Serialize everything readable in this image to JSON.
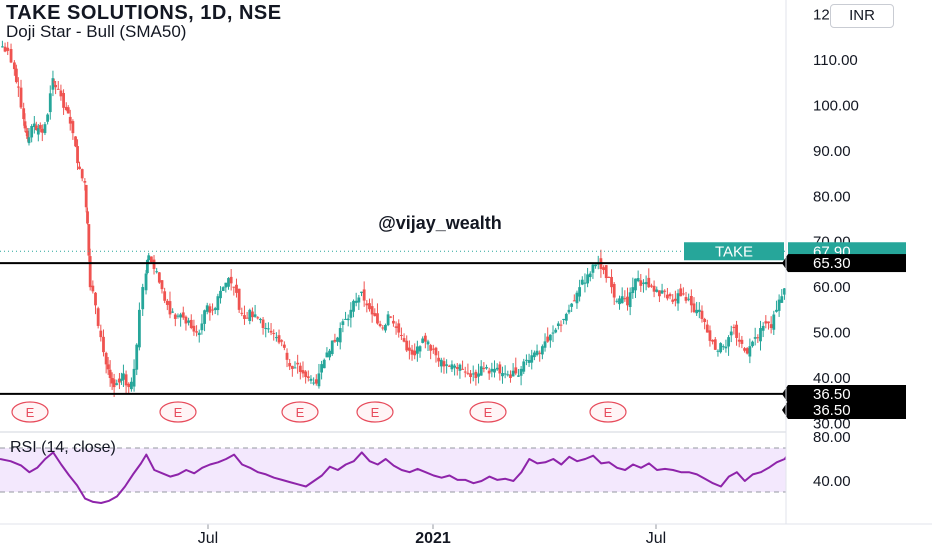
{
  "header": {
    "title": "TAKE SOLUTIONS, 1D, NSE",
    "indicator": "Doji Star - Bull (SMA50)",
    "currency": "INR"
  },
  "watermark": "@vijay_wealth",
  "colors": {
    "up": "#26a69a",
    "down": "#ef5350",
    "rsi_line": "#8e24aa",
    "rsi_band": "#f3e8fd",
    "support_line": "#000000",
    "last_price_tag": "#26a69a",
    "earnings": "#e74c5c"
  },
  "chart_data": [
    {
      "type": "candlestick",
      "title": "TAKE SOLUTIONS, 1D, NSE",
      "ylim": [
        28,
        122
      ],
      "y_ticks": [
        "30.00",
        "40.00",
        "50.00",
        "60.00",
        "70.00",
        "80.00",
        "90.00",
        "100.00",
        "110.00",
        "120.00"
      ],
      "x_ticks": [
        "Jul",
        "2021",
        "Jul"
      ],
      "grid": false,
      "last_price": {
        "symbol": "TAKE",
        "value": "67.90"
      },
      "horizontal_levels": [
        {
          "value": 65.3,
          "label": "65.30"
        },
        {
          "value": 36.5,
          "label": "36.50"
        },
        {
          "value": 36.5,
          "label": "36.50"
        }
      ],
      "earnings_markers": [
        "E",
        "E",
        "E",
        "E",
        "E",
        "E"
      ],
      "close_path": [
        [
          0,
          113
        ],
        [
          4,
          112
        ],
        [
          9,
          108
        ],
        [
          12,
          104
        ],
        [
          16,
          97
        ],
        [
          18,
          94
        ],
        [
          20,
          93
        ],
        [
          24,
          96
        ],
        [
          27,
          95
        ],
        [
          30,
          94
        ],
        [
          34,
          98
        ],
        [
          38,
          106
        ],
        [
          40,
          104
        ],
        [
          44,
          102
        ],
        [
          48,
          99
        ],
        [
          51,
          96
        ],
        [
          55,
          91
        ],
        [
          58,
          86
        ],
        [
          62,
          83
        ],
        [
          64,
          74
        ],
        [
          66,
          60
        ],
        [
          70,
          56
        ],
        [
          74,
          49
        ],
        [
          78,
          43
        ],
        [
          81,
          40
        ],
        [
          84,
          38
        ],
        [
          88,
          39
        ],
        [
          91,
          41
        ],
        [
          95,
          38
        ],
        [
          99,
          42
        ],
        [
          103,
          55
        ],
        [
          108,
          63
        ],
        [
          110,
          67
        ],
        [
          114,
          64
        ],
        [
          118,
          61
        ],
        [
          122,
          57
        ],
        [
          126,
          54
        ],
        [
          130,
          53
        ],
        [
          134,
          54
        ],
        [
          138,
          52
        ],
        [
          142,
          51
        ],
        [
          146,
          50
        ],
        [
          150,
          52
        ],
        [
          154,
          56
        ],
        [
          158,
          55
        ],
        [
          162,
          58
        ],
        [
          166,
          60
        ],
        [
          170,
          62
        ],
        [
          174,
          60
        ],
        [
          178,
          55
        ],
        [
          182,
          53
        ],
        [
          186,
          55
        ],
        [
          190,
          54
        ],
        [
          194,
          53
        ],
        [
          198,
          51
        ],
        [
          202,
          50
        ],
        [
          206,
          49
        ],
        [
          210,
          48
        ],
        [
          214,
          44
        ],
        [
          218,
          42
        ],
        [
          222,
          43
        ],
        [
          226,
          41
        ],
        [
          230,
          40
        ],
        [
          234,
          39
        ],
        [
          238,
          41
        ],
        [
          242,
          44
        ],
        [
          246,
          46
        ],
        [
          250,
          48
        ],
        [
          254,
          51
        ],
        [
          258,
          53
        ],
        [
          262,
          55
        ],
        [
          266,
          57
        ],
        [
          270,
          59
        ],
        [
          274,
          56
        ],
        [
          278,
          54
        ],
        [
          282,
          52
        ],
        [
          286,
          51
        ],
        [
          290,
          54
        ],
        [
          294,
          52
        ],
        [
          298,
          50
        ],
        [
          302,
          48
        ],
        [
          306,
          46
        ],
        [
          310,
          45
        ],
        [
          314,
          47
        ],
        [
          318,
          48
        ],
        [
          322,
          46
        ],
        [
          326,
          45
        ],
        [
          330,
          44
        ],
        [
          334,
          43
        ],
        [
          338,
          43
        ],
        [
          342,
          42
        ],
        [
          346,
          42
        ],
        [
          350,
          41
        ],
        [
          354,
          41
        ],
        [
          358,
          41
        ],
        [
          362,
          42
        ],
        [
          366,
          41
        ],
        [
          370,
          42
        ],
        [
          374,
          41
        ],
        [
          378,
          41
        ],
        [
          382,
          40
        ],
        [
          386,
          41
        ],
        [
          390,
          42
        ],
        [
          394,
          44
        ],
        [
          398,
          45
        ],
        [
          402,
          46
        ],
        [
          406,
          47
        ],
        [
          410,
          48
        ],
        [
          414,
          50
        ],
        [
          418,
          52
        ],
        [
          422,
          53
        ],
        [
          426,
          55
        ],
        [
          430,
          57
        ],
        [
          434,
          60
        ],
        [
          438,
          61
        ],
        [
          442,
          63
        ],
        [
          446,
          65
        ],
        [
          450,
          64
        ],
        [
          454,
          62
        ],
        [
          458,
          60
        ],
        [
          462,
          57
        ],
        [
          466,
          58
        ],
        [
          470,
          56
        ],
        [
          474,
          60
        ],
        [
          478,
          62
        ],
        [
          482,
          61
        ],
        [
          486,
          60
        ],
        [
          490,
          59
        ],
        [
          494,
          58
        ],
        [
          498,
          59
        ],
        [
          502,
          58
        ],
        [
          506,
          57
        ],
        [
          510,
          58
        ],
        [
          514,
          57
        ],
        [
          518,
          56
        ],
        [
          522,
          55
        ],
        [
          526,
          53
        ],
        [
          530,
          50
        ],
        [
          534,
          48
        ],
        [
          538,
          46
        ],
        [
          542,
          47
        ],
        [
          546,
          49
        ],
        [
          550,
          51
        ],
        [
          554,
          48
        ],
        [
          558,
          46
        ],
        [
          562,
          47
        ],
        [
          566,
          49
        ],
        [
          570,
          51
        ],
        [
          574,
          52
        ],
        [
          578,
          51
        ],
        [
          582,
          55
        ],
        [
          586,
          58
        ],
        [
          590,
          60
        ],
        [
          594,
          61
        ],
        [
          598,
          70
        ],
        [
          602,
          66
        ],
        [
          606,
          67.9
        ]
      ]
    },
    {
      "type": "line",
      "title": "RSI (14, close)",
      "ylim": [
        15,
        85
      ],
      "y_ticks": [
        "40.00",
        "80.00"
      ],
      "band": [
        70,
        30
      ],
      "series": [
        {
          "name": "RSI (14, close)",
          "points": [
            [
              0,
              60
            ],
            [
              8,
              58
            ],
            [
              16,
              54
            ],
            [
              22,
              48
            ],
            [
              28,
              52
            ],
            [
              34,
              60
            ],
            [
              40,
              66
            ],
            [
              46,
              55
            ],
            [
              52,
              45
            ],
            [
              58,
              36
            ],
            [
              64,
              24
            ],
            [
              70,
              21
            ],
            [
              76,
              20
            ],
            [
              82,
              22
            ],
            [
              88,
              26
            ],
            [
              94,
              35
            ],
            [
              100,
              46
            ],
            [
              106,
              56
            ],
            [
              110,
              64
            ],
            [
              116,
              50
            ],
            [
              122,
              47
            ],
            [
              128,
              44
            ],
            [
              134,
              46
            ],
            [
              140,
              50
            ],
            [
              146,
              47
            ],
            [
              152,
              52
            ],
            [
              158,
              55
            ],
            [
              164,
              57
            ],
            [
              170,
              60
            ],
            [
              176,
              64
            ],
            [
              182,
              55
            ],
            [
              188,
              52
            ],
            [
              194,
              48
            ],
            [
              200,
              46
            ],
            [
              206,
              43
            ],
            [
              212,
              41
            ],
            [
              218,
              39
            ],
            [
              224,
              37
            ],
            [
              230,
              35
            ],
            [
              236,
              40
            ],
            [
              242,
              45
            ],
            [
              248,
              53
            ],
            [
              254,
              50
            ],
            [
              260,
              55
            ],
            [
              266,
              58
            ],
            [
              272,
              66
            ],
            [
              278,
              58
            ],
            [
              284,
              55
            ],
            [
              290,
              60
            ],
            [
              296,
              54
            ],
            [
              302,
              50
            ],
            [
              308,
              48
            ],
            [
              314,
              51
            ],
            [
              320,
              48
            ],
            [
              326,
              45
            ],
            [
              332,
              43
            ],
            [
              338,
              45
            ],
            [
              344,
              41
            ],
            [
              350,
              41
            ],
            [
              356,
              38
            ],
            [
              362,
              40
            ],
            [
              368,
              44
            ],
            [
              374,
              41
            ],
            [
              380,
              42
            ],
            [
              386,
              40
            ],
            [
              392,
              48
            ],
            [
              398,
              60
            ],
            [
              404,
              56
            ],
            [
              410,
              57
            ],
            [
              416,
              60
            ],
            [
              422,
              55
            ],
            [
              428,
              62
            ],
            [
              434,
              58
            ],
            [
              440,
              60
            ],
            [
              446,
              63
            ],
            [
              452,
              56
            ],
            [
              458,
              57
            ],
            [
              464,
              52
            ],
            [
              470,
              50
            ],
            [
              476,
              55
            ],
            [
              482,
              52
            ],
            [
              488,
              56
            ],
            [
              494,
              50
            ],
            [
              500,
              51
            ],
            [
              506,
              50
            ],
            [
              512,
              48
            ],
            [
              518,
              48
            ],
            [
              524,
              46
            ],
            [
              530,
              42
            ],
            [
              536,
              38
            ],
            [
              542,
              35
            ],
            [
              548,
              44
            ],
            [
              554,
              48
            ],
            [
              560,
              40
            ],
            [
              566,
              46
            ],
            [
              572,
              48
            ],
            [
              578,
              52
            ],
            [
              584,
              57
            ],
            [
              590,
              60
            ],
            [
              596,
              70
            ],
            [
              602,
              65
            ],
            [
              608,
              62
            ]
          ]
        }
      ]
    }
  ]
}
